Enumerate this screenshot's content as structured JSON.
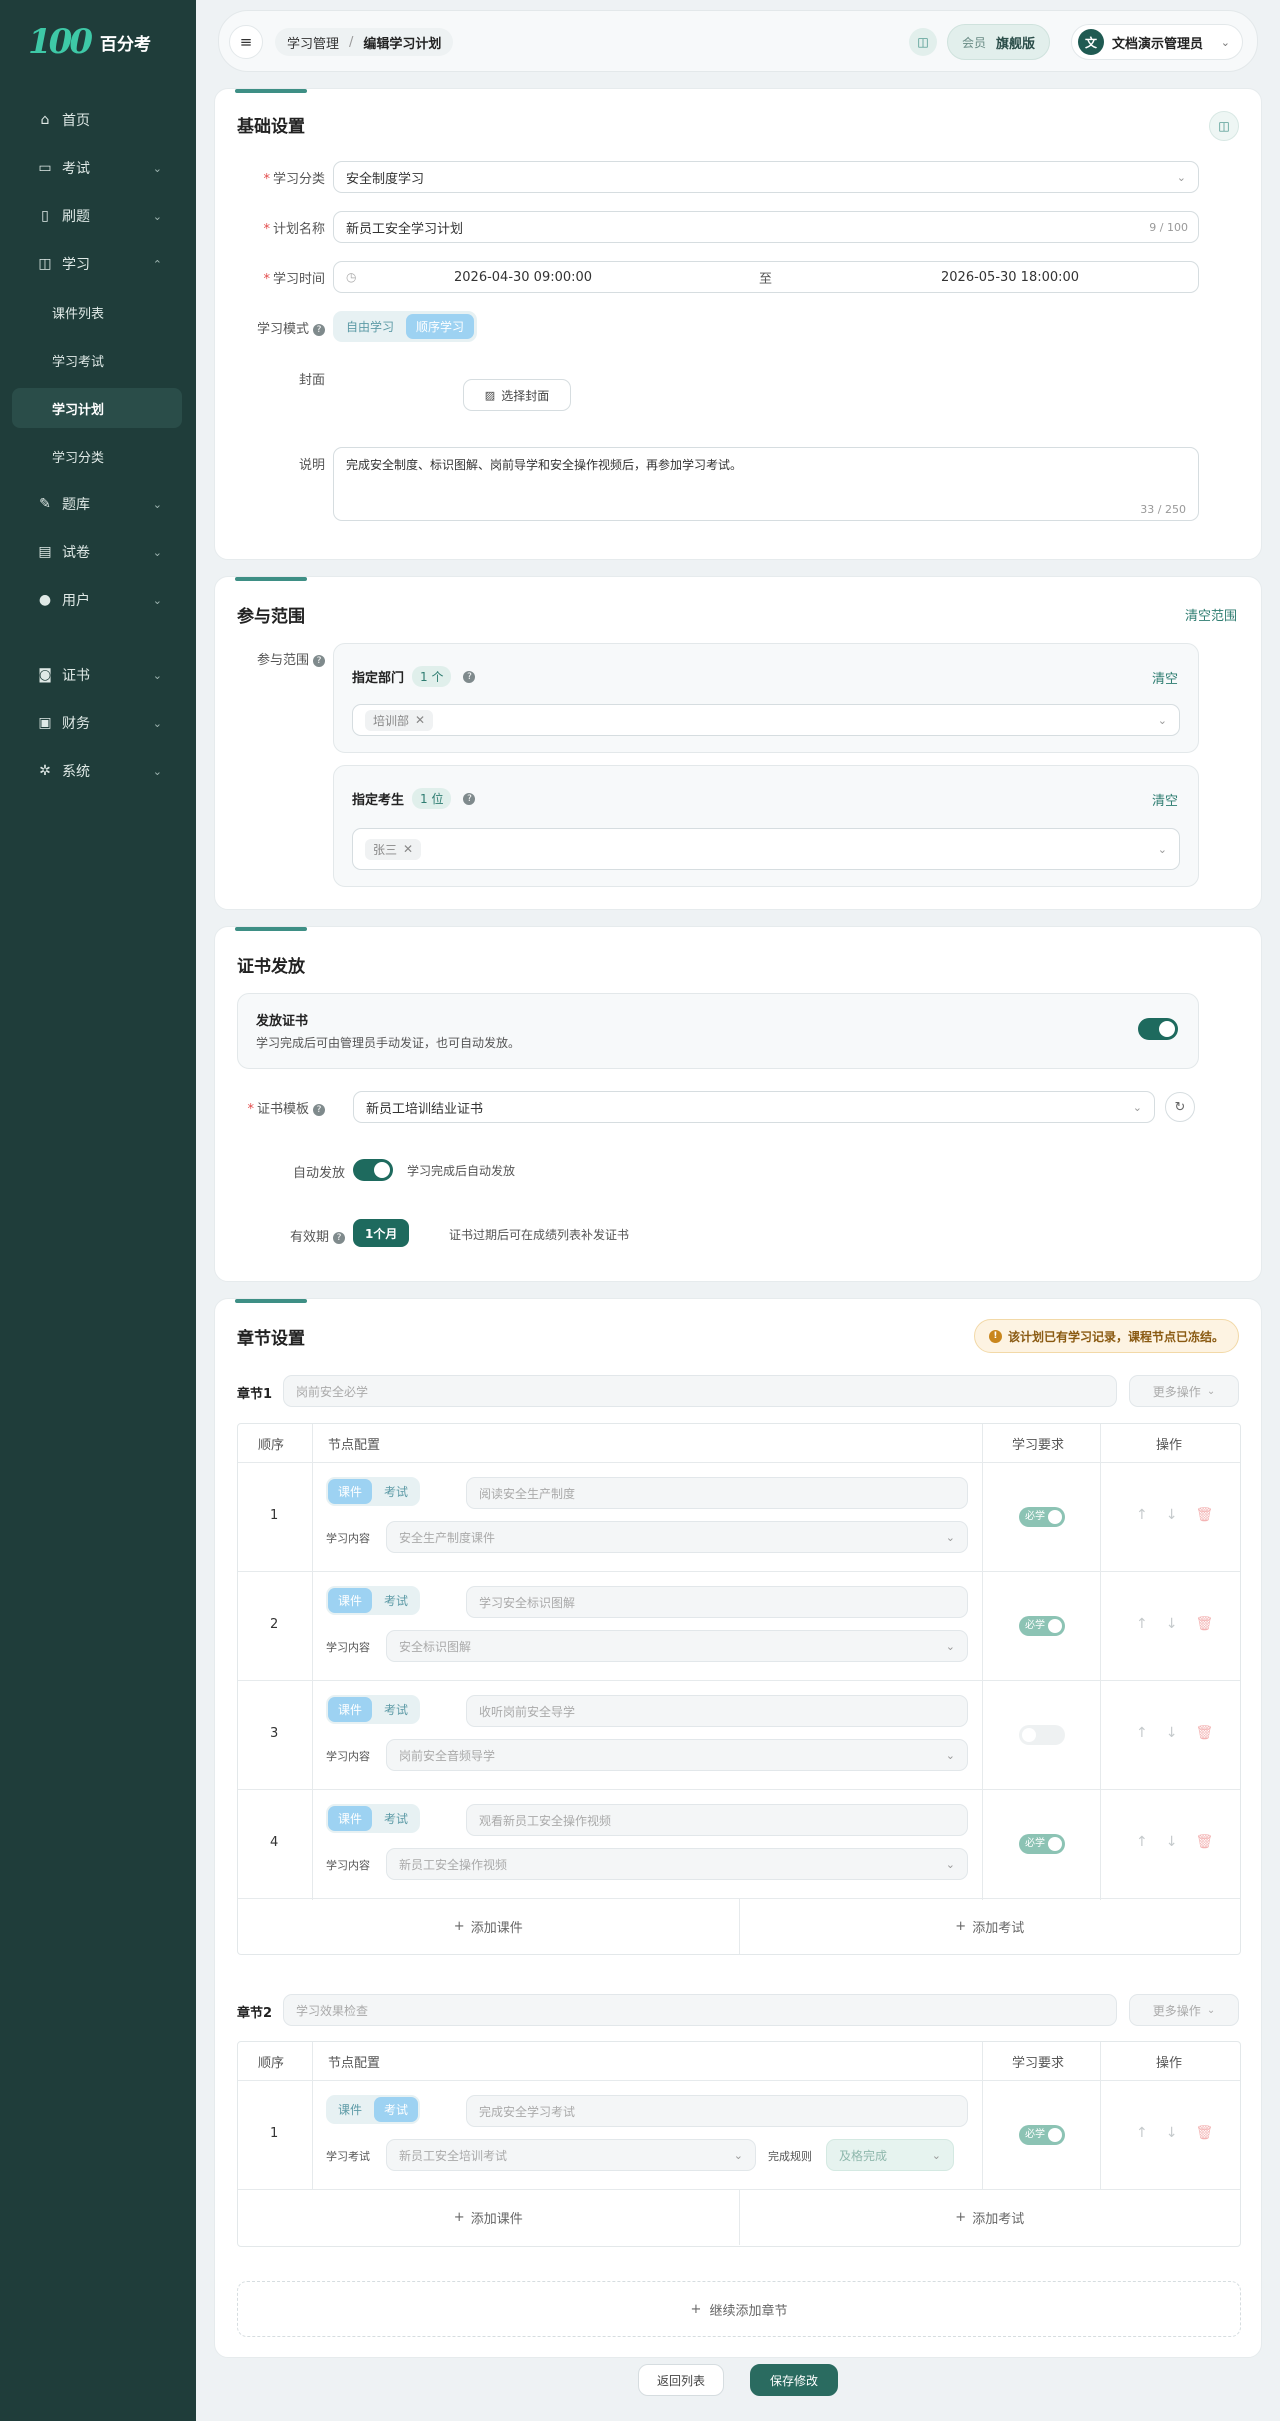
{
  "brand": {
    "logo": "100",
    "name": "百分考"
  },
  "sidebar": {
    "items": [
      {
        "label": "首页",
        "icon": "home-icon"
      },
      {
        "label": "考试",
        "icon": "exam-icon"
      },
      {
        "label": "刷题",
        "icon": "practice-icon"
      },
      {
        "label": "学习",
        "icon": "book-icon"
      },
      {
        "label": "课件列表"
      },
      {
        "label": "学习考试"
      },
      {
        "label": "学习计划"
      },
      {
        "label": "学习分类"
      },
      {
        "label": "题库",
        "icon": "edit-icon"
      },
      {
        "label": "试卷",
        "icon": "paper-icon"
      },
      {
        "label": "用户",
        "icon": "user-icon"
      },
      {
        "label": "证书",
        "icon": "certificate-icon"
      },
      {
        "label": "财务",
        "icon": "finance-icon"
      },
      {
        "label": "系统",
        "icon": "gear-icon"
      }
    ]
  },
  "topbar": {
    "breadcrumb": [
      "学习管理",
      "/",
      "编辑学习计划"
    ],
    "member_label": "会员",
    "plan": "旗舰版",
    "avatar": "文",
    "user": "文档演示管理员"
  },
  "basic": {
    "title": "基础设置",
    "category_label": "学习分类",
    "category_value": "安全制度学习",
    "name_label": "计划名称",
    "name_value": "新员工安全学习计划",
    "name_count": "9 / 100",
    "time_label": "学习时间",
    "time_start": "2026-04-30 09:00:00",
    "time_sep": "至",
    "time_end": "2026-05-30 18:00:00",
    "mode_label": "学习模式",
    "mode_free": "自由学习",
    "mode_seq": "顺序学习",
    "cover_label": "封面",
    "cover_button": "选择封面",
    "desc_label": "说明",
    "desc_value": "完成安全制度、标识图解、岗前导学和安全操作视频后，再参加学习考试。",
    "desc_count": "33 / 250"
  },
  "scope": {
    "title": "参与范围",
    "clear_all": "清空范围",
    "label": "参与范围",
    "dept_title": "指定部门",
    "dept_count": "1 个",
    "dept_clear": "清空",
    "dept_tag": "培训部",
    "student_title": "指定考生",
    "student_count": "1 位",
    "student_clear": "清空",
    "student_tag": "张三"
  },
  "cert": {
    "title": "证书发放",
    "issue_title": "发放证书",
    "issue_desc": "学习完成后可由管理员手动发证，也可自动发放。",
    "issue_on": true,
    "template_label": "证书模板",
    "template_value": "新员工培训结业证书",
    "auto_label": "自动发放",
    "auto_desc": "学习完成后自动发放",
    "auto_on": true,
    "validity_label": "有效期",
    "validity_value": "1个月",
    "validity_desc": "证书过期后可在成绩列表补发证书"
  },
  "chapters": {
    "title": "章节设置",
    "notice": "该计划已有学习记录，课程节点已冻结。",
    "headers": [
      "顺序",
      "节点配置",
      "学习要求",
      "操作"
    ],
    "more_ops": "更多操作",
    "add_course": "添加课件",
    "add_exam": "添加考试",
    "add_chapter": "继续添加章节",
    "list": [
      {
        "label": "章节1",
        "name": "岗前安全必学",
        "rows": [
          {
            "order": "1",
            "type_a": "课件",
            "type_b": "考试",
            "active": "a",
            "node_name": "阅读安全生产制度",
            "content_label": "学习内容",
            "content": "安全生产制度课件",
            "req": "必学",
            "req_on": true
          },
          {
            "order": "2",
            "type_a": "课件",
            "type_b": "考试",
            "active": "a",
            "node_name": "学习安全标识图解",
            "content_label": "学习内容",
            "content": "安全标识图解",
            "req": "必学",
            "req_on": true
          },
          {
            "order": "3",
            "type_a": "课件",
            "type_b": "考试",
            "active": "a",
            "node_name": "收听岗前安全导学",
            "content_label": "学习内容",
            "content": "岗前安全音频导学",
            "req": "",
            "req_on": false
          },
          {
            "order": "4",
            "type_a": "课件",
            "type_b": "考试",
            "active": "a",
            "node_name": "观看新员工安全操作视频",
            "content_label": "学习内容",
            "content": "新员工安全操作视频",
            "req": "必学",
            "req_on": true
          }
        ]
      },
      {
        "label": "章节2",
        "name": "学习效果检查",
        "rows": [
          {
            "order": "1",
            "type_a": "课件",
            "type_b": "考试",
            "active": "b",
            "node_name": "完成安全学习考试",
            "content_label": "学习考试",
            "content": "新员工安全培训考试",
            "rule_label": "完成规则",
            "rule": "及格完成",
            "req": "必学",
            "req_on": true
          }
        ]
      }
    ]
  },
  "footer": {
    "back": "返回列表",
    "save": "保存修改"
  }
}
